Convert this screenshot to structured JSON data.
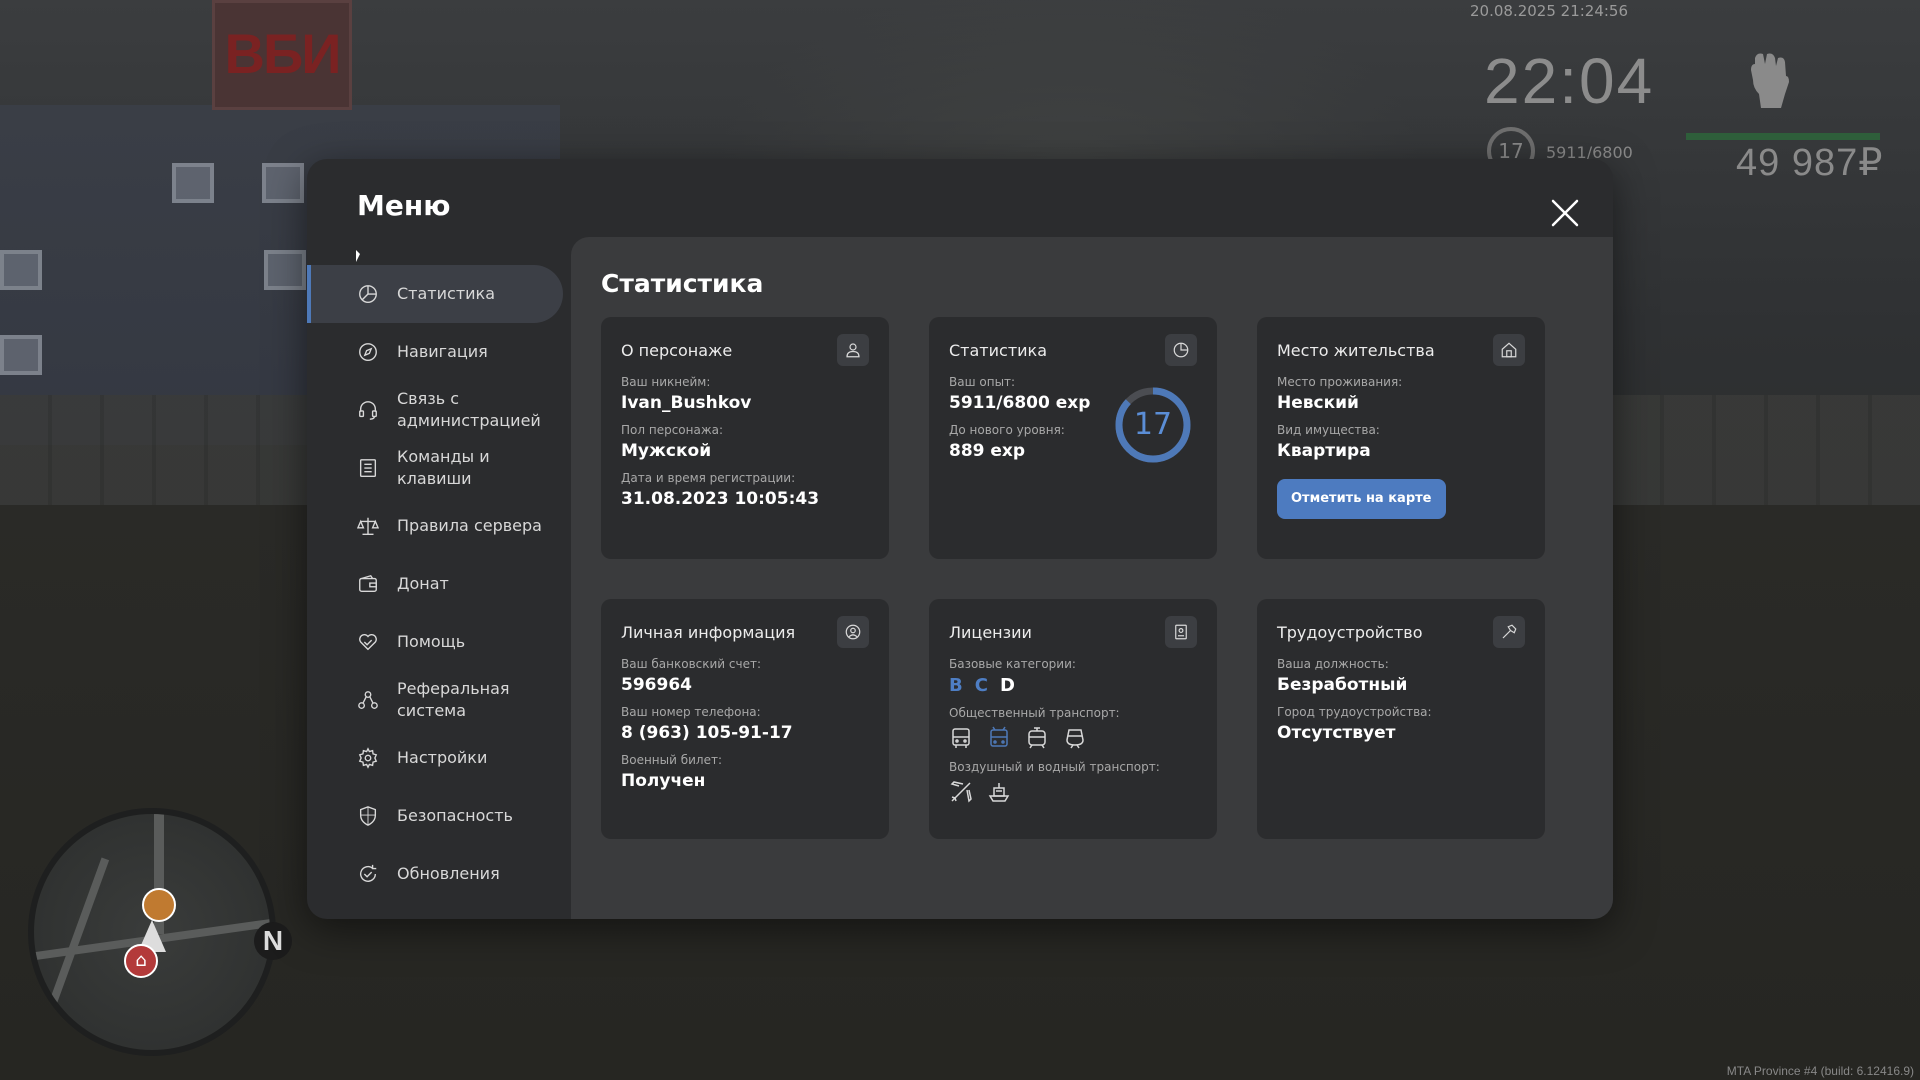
{
  "hud": {
    "datetime": "20.08.2025 21:24:56",
    "clock": "22:04",
    "level": "17",
    "exp": "5911/6800",
    "money": "49 987₽",
    "build": "MTA Province #4 (build: 6.12416.9)",
    "minimap_north": "N"
  },
  "background": {
    "sign_text": "ВБИ"
  },
  "menu": {
    "title": "Меню",
    "sidebar": [
      {
        "label": "Статистика",
        "icon": "pie-chart-icon",
        "active": true
      },
      {
        "label": "Навигация",
        "icon": "compass-icon",
        "active": false
      },
      {
        "label": "Связь с администрацией",
        "icon": "headset-icon",
        "active": false
      },
      {
        "label": "Команды и клавиши",
        "icon": "document-icon",
        "active": false
      },
      {
        "label": "Правила сервера",
        "icon": "scales-icon",
        "active": false
      },
      {
        "label": "Донат",
        "icon": "wallet-icon",
        "active": false
      },
      {
        "label": "Помощь",
        "icon": "heart-hand-icon",
        "active": false
      },
      {
        "label": "Реферальная система",
        "icon": "referral-icon",
        "active": false
      },
      {
        "label": "Настройки",
        "icon": "gear-icon",
        "active": false
      },
      {
        "label": "Безопасность",
        "icon": "shield-icon",
        "active": false
      },
      {
        "label": "Обновления",
        "icon": "update-icon",
        "active": false
      }
    ]
  },
  "content": {
    "title": "Статистика",
    "character": {
      "title": "О персонаже",
      "nickname_label": "Ваш никнейм:",
      "nickname": "Ivan_Bushkov",
      "gender_label": "Пол персонажа:",
      "gender": "Мужской",
      "reg_label": "Дата и время регистрации:",
      "reg": "31.08.2023 10:05:43"
    },
    "stats": {
      "title": "Статистика",
      "exp_label": "Ваш опыт:",
      "exp": "5911/6800 exp",
      "next_label": "До нового уровня:",
      "next": "889 exp",
      "level": "17",
      "progress": 0.869
    },
    "residence": {
      "title": "Место жительства",
      "place_label": "Место проживания:",
      "place": "Невский",
      "type_label": "Вид имущества:",
      "type": "Квартира",
      "button": "Отметить на карте"
    },
    "personal": {
      "title": "Личная информация",
      "bank_label": "Ваш банковский счет:",
      "bank": "596964",
      "phone_label": "Ваш номер телефона:",
      "phone": "8 (963) 105-91-17",
      "military_label": "Военный билет:",
      "military": "Получен"
    },
    "licenses": {
      "title": "Лицензии",
      "base_label": "Базовые категории:",
      "categories": [
        {
          "name": "B",
          "owned": false
        },
        {
          "name": "C",
          "owned": false
        },
        {
          "name": "D",
          "owned": true
        }
      ],
      "public_label": "Общественный транспорт:",
      "air_label": "Воздушный и водный транспорт:"
    },
    "employment": {
      "title": "Трудоустройство",
      "position_label": "Ваша должность:",
      "position": "Безработный",
      "city_label": "Город трудоустройства:",
      "city": "Отсутствует"
    }
  },
  "colors": {
    "accent": "#4e79b8",
    "panel": "#2b2c2e",
    "content": "#3a3b3d",
    "card": "#2b2c2e"
  }
}
